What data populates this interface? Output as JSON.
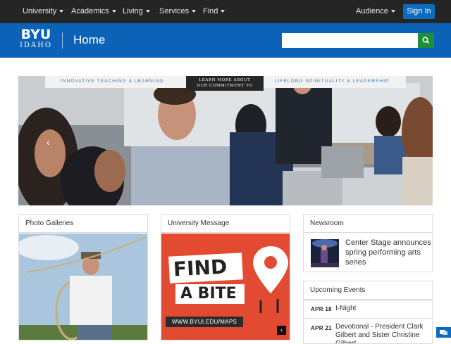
{
  "nav": {
    "items": [
      {
        "label": "University"
      },
      {
        "label": "Academics"
      },
      {
        "label": "Living"
      },
      {
        "label": "Services"
      },
      {
        "label": "Find"
      }
    ],
    "audience_label": "Audience",
    "signin_label": "Sign In"
  },
  "header": {
    "logo_top": "BYU",
    "logo_bottom": "IDAHO",
    "page_title": "Home",
    "search_value": "",
    "search_icon": "search-icon"
  },
  "hero": {
    "banner_left": "INNOVATIVE TEACHING & LEARNING",
    "banner_mid_line1": "LEARN MORE ABOUT",
    "banner_mid_line2": "OUR COMMITMENT TO",
    "banner_right": "LIFELONG SPIRITUALITY & LEADERSHIP"
  },
  "cards": {
    "photo": {
      "title": "Photo Galleries"
    },
    "message": {
      "title": "University Message",
      "sign1": "FIND",
      "sign2": "A BITE",
      "url": "WWW.BYUI.EDU/MAPS"
    },
    "newsroom": {
      "title": "Newsroom",
      "headline": "Center Stage announces spring performing arts series"
    },
    "events": {
      "title": "Upcoming Events",
      "items": [
        {
          "date": "APR 18",
          "name": "I-Night"
        },
        {
          "date": "APR 21",
          "name": "Devotional - President Clark Gilbert and Sister Christine Gilbert"
        }
      ]
    }
  },
  "colors": {
    "nav_bg": "#252525",
    "header_blue": "#0b62b6",
    "signin_blue": "#0d6bbf",
    "search_green": "#1e8f3a",
    "message_red": "#e24b32"
  }
}
